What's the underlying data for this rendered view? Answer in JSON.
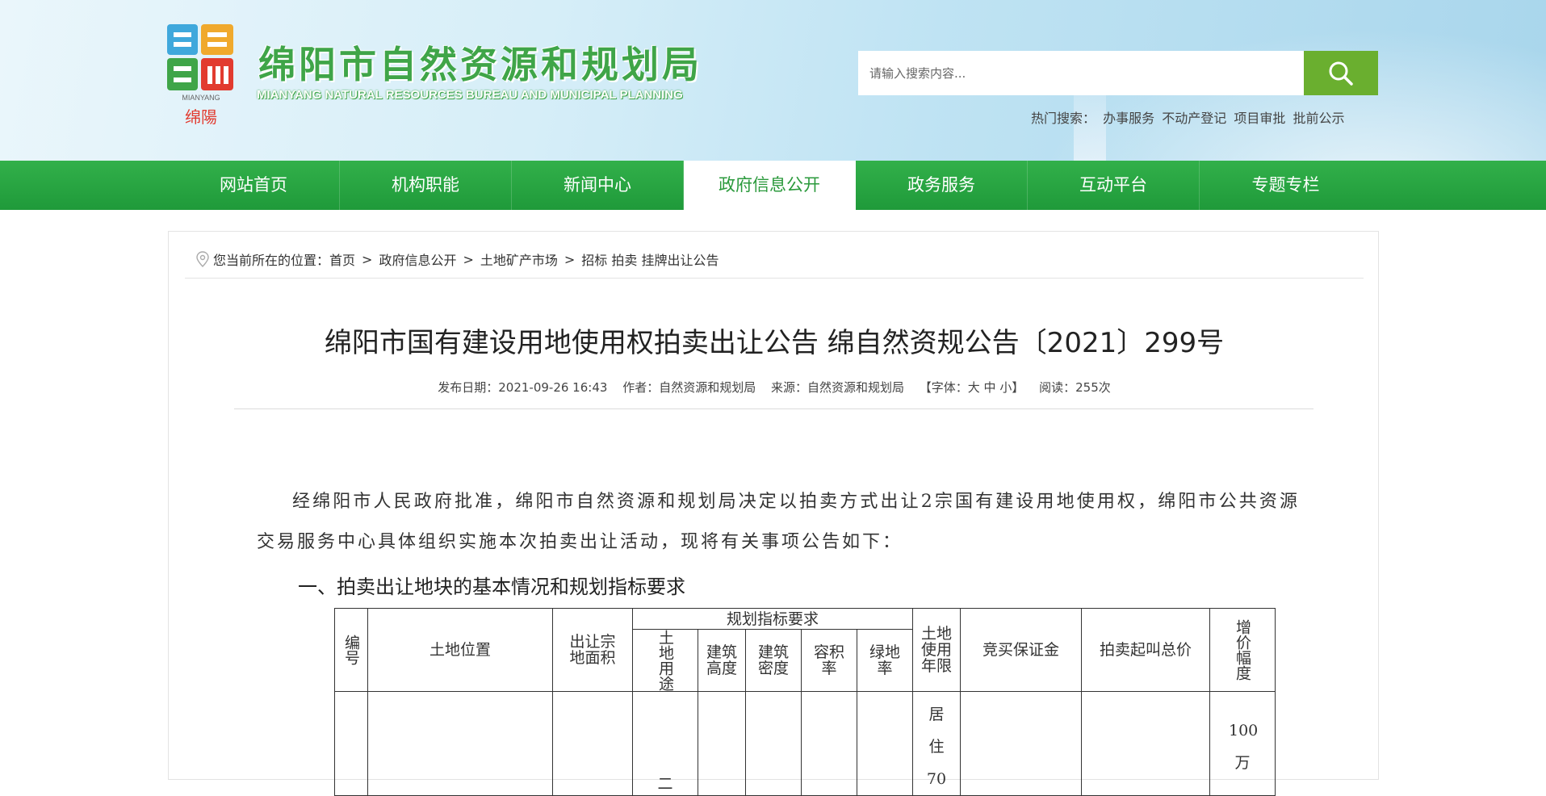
{
  "header": {
    "logo_name": "MIANYANG",
    "logo_small": "绵陽",
    "site_title": "绵阳市自然资源和规划局",
    "site_subtitle": "MIANYANG NATURAL RESOURCES BUREAU AND MUNICIPAL PLANNING",
    "search_placeholder": "请输入搜索内容...",
    "hot_label": "热门搜索：",
    "hot_items": [
      "办事服务",
      "不动产登记",
      "项目审批",
      "批前公示"
    ]
  },
  "nav": {
    "items": [
      "网站首页",
      "机构职能",
      "新闻中心",
      "政府信息公开",
      "政务服务",
      "互动平台",
      "专题专栏"
    ],
    "active_index": 3
  },
  "breadcrumb": {
    "label": "您当前所在的位置：",
    "items": [
      "首页",
      "政府信息公开",
      "土地矿产市场",
      "招标 拍卖 挂牌出让公告"
    ],
    "separator": ">"
  },
  "article": {
    "title": "绵阳市国有建设用地使用权拍卖出让公告 绵自然资规公告〔2021〕299号",
    "meta": {
      "date": "发布日期：2021-09-26 16:43",
      "author": "作者：自然资源和规划局",
      "source": "来源：自然资源和规划局",
      "font_size": "【字体：大 中 小】",
      "reads": "阅读：255次"
    },
    "paragraph": "经绵阳市人民政府批准，绵阳市自然资源和规划局决定以拍卖方式出让2宗国有建设用地使用权，绵阳市公共资源交易服务中心具体组织实施本次拍卖出让活动，现将有关事项公告如下：",
    "section_title": "一、拍卖出让地块的基本情况和规划指标要求"
  },
  "table": {
    "headers": {
      "no": "编号",
      "location": "土地位置",
      "area": "出让宗地面积",
      "planning_group": "规划指标要求",
      "use": "土地用途",
      "height": "建筑高度",
      "density": "建筑密度",
      "far": "容积率",
      "green": "绿地率",
      "term": "土地使用年限",
      "deposit": "竞买保证金",
      "start_price": "拍卖起叫总价",
      "increment": "增价幅度"
    },
    "row1": {
      "use_partial": "二",
      "term_partial": "居住 70",
      "increment_partial": "100 万"
    }
  },
  "colors": {
    "nav_green": "#2aa944",
    "title_green": "#3fa548",
    "search_button": "#6aaf2f"
  }
}
